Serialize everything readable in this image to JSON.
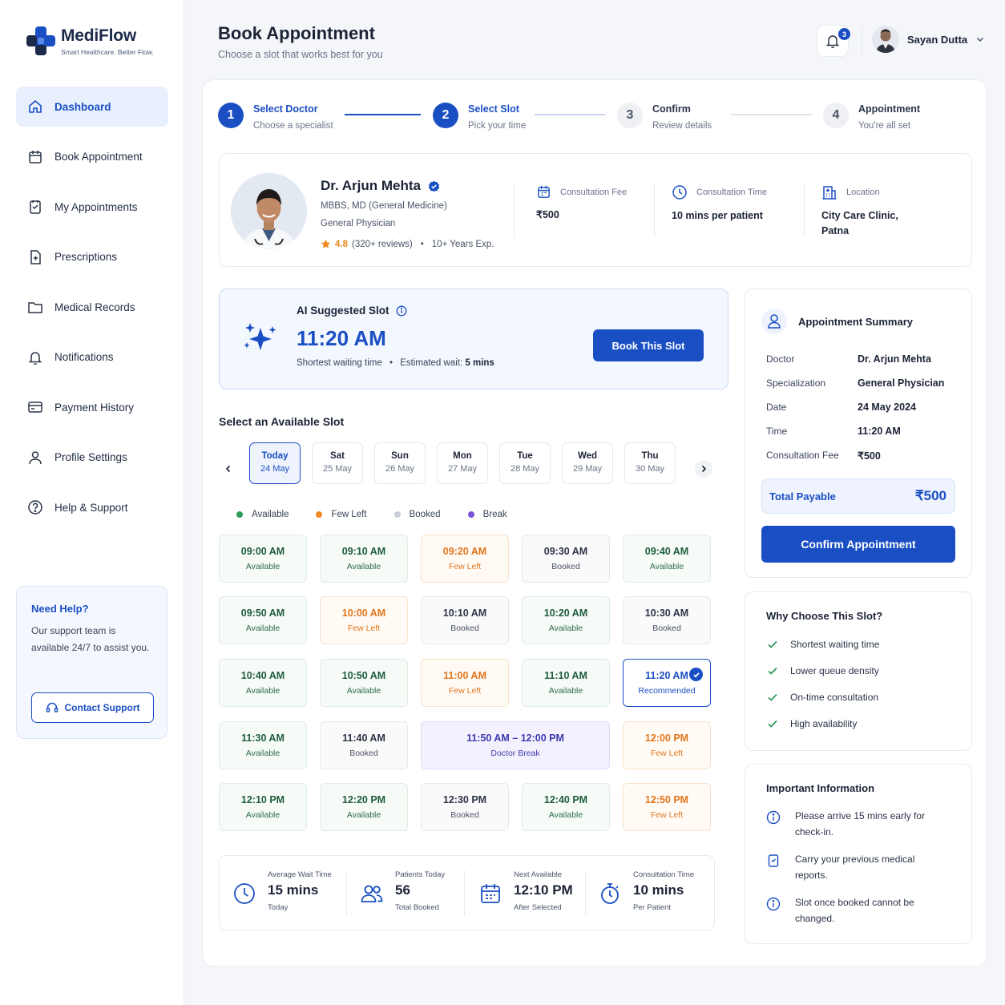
{
  "brand": {
    "name": "MediFlow",
    "tagline": "Smart Healthcare. Better Flow.",
    "accent": "#1a4fc4"
  },
  "sidebar": {
    "items": [
      {
        "label": "Dashboard",
        "icon": "home-icon",
        "active": true
      },
      {
        "label": "Book Appointment",
        "icon": "calendar-icon"
      },
      {
        "label": "My Appointments",
        "icon": "clipboard-calendar-icon"
      },
      {
        "label": "Prescriptions",
        "icon": "prescription-icon"
      },
      {
        "label": "Medical Records",
        "icon": "folder-icon"
      },
      {
        "label": "Notifications",
        "icon": "bell-icon"
      },
      {
        "label": "Payment History",
        "icon": "card-icon"
      },
      {
        "label": "Profile Settings",
        "icon": "user-icon"
      },
      {
        "label": "Help & Support",
        "icon": "question-icon"
      }
    ],
    "help": {
      "title": "Need Help?",
      "text": "Our support team is available 24/7 to assist you.",
      "button": "Contact Support"
    }
  },
  "header": {
    "title": "Book Appointment",
    "subtitle": "Choose a slot that works best for you",
    "notification_count": "3",
    "user_name": "Sayan Dutta"
  },
  "steps": [
    {
      "num": "1",
      "title": "Select Doctor",
      "sub": "Choose a specialist",
      "state": "done"
    },
    {
      "num": "2",
      "title": "Select Slot",
      "sub": "Pick your time",
      "state": "current"
    },
    {
      "num": "3",
      "title": "Confirm",
      "sub": "Review details",
      "state": "todo"
    },
    {
      "num": "4",
      "title": "Appointment",
      "sub": "You're all set",
      "state": "todo"
    }
  ],
  "doctor": {
    "name": "Dr. Arjun Mehta",
    "degree": "MBBS, MD (General Medicine)",
    "specialty": "General Physician",
    "rating": "4.8",
    "reviews": "(320+ reviews)",
    "experience": "10+ Years Exp.",
    "fee_label": "Consultation Fee",
    "fee": "₹500",
    "time_label": "Consultation Time",
    "time": "10 mins per patient",
    "location_label": "Location",
    "location": "City Care Clinic, Patna"
  },
  "ai_slot": {
    "title": "AI Suggested Slot",
    "time": "11:20 AM",
    "note": "Shortest waiting time",
    "wait_label": "Estimated wait:",
    "wait": "5 mins",
    "button": "Book This Slot"
  },
  "slots_section": {
    "title": "Select an Available Slot",
    "days": [
      {
        "d": "Today",
        "date": "24 May",
        "selected": true
      },
      {
        "d": "Sat",
        "date": "25 May"
      },
      {
        "d": "Sun",
        "date": "26 May"
      },
      {
        "d": "Mon",
        "date": "27 May"
      },
      {
        "d": "Tue",
        "date": "28 May"
      },
      {
        "d": "Wed",
        "date": "29 May"
      },
      {
        "d": "Thu",
        "date": "30 May"
      }
    ],
    "legend": [
      {
        "label": "Available",
        "color": "#2e9a5c"
      },
      {
        "label": "Few Left",
        "color": "#f08a24"
      },
      {
        "label": "Booked",
        "color": "#c9ced8"
      },
      {
        "label": "Break",
        "color": "#7a52d6"
      }
    ],
    "rows": [
      [
        {
          "time": "09:00 AM",
          "status": "Available",
          "kind": "av"
        },
        {
          "time": "09:10 AM",
          "status": "Available",
          "kind": "av"
        },
        {
          "time": "09:20 AM",
          "status": "Few Left",
          "kind": "fl"
        },
        {
          "time": "09:30 AM",
          "status": "Booked",
          "kind": "bk"
        },
        {
          "time": "09:40 AM",
          "status": "Available",
          "kind": "av"
        }
      ],
      [
        {
          "time": "09:50 AM",
          "status": "Available",
          "kind": "av"
        },
        {
          "time": "10:00 AM",
          "status": "Few Left",
          "kind": "fl"
        },
        {
          "time": "10:10 AM",
          "status": "Booked",
          "kind": "bk"
        },
        {
          "time": "10:20 AM",
          "status": "Available",
          "kind": "av"
        },
        {
          "time": "10:30 AM",
          "status": "Booked",
          "kind": "bk"
        }
      ],
      [
        {
          "time": "10:40 AM",
          "status": "Available",
          "kind": "av"
        },
        {
          "time": "10:50 AM",
          "status": "Available",
          "kind": "av"
        },
        {
          "time": "11:00 AM",
          "status": "Few Left",
          "kind": "fl"
        },
        {
          "time": "11:10 AM",
          "status": "Available",
          "kind": "av"
        },
        {
          "time": "11:20 AM",
          "status": "Recommended",
          "kind": "rc"
        }
      ],
      [
        {
          "time": "11:30 AM",
          "status": "Available",
          "kind": "av"
        },
        {
          "time": "11:40 AM",
          "status": "Booked",
          "kind": "bk"
        },
        {
          "time": "11:50 AM – 12:00 PM",
          "status": "Doctor Break",
          "kind": "br"
        },
        {
          "time": "12:00 PM",
          "status": "Few Left",
          "kind": "fl"
        }
      ],
      [
        {
          "time": "12:10 PM",
          "status": "Available",
          "kind": "av"
        },
        {
          "time": "12:20 PM",
          "status": "Available",
          "kind": "av"
        },
        {
          "time": "12:30 PM",
          "status": "Booked",
          "kind": "bk"
        },
        {
          "time": "12:40 PM",
          "status": "Available",
          "kind": "av"
        },
        {
          "time": "12:50 PM",
          "status": "Few Left",
          "kind": "fl"
        }
      ]
    ]
  },
  "stats": [
    {
      "label": "Average Wait Time",
      "value": "15 mins",
      "sub": "Today",
      "icon": "clock-icon"
    },
    {
      "label": "Patients Today",
      "value": "56",
      "sub": "Total Booked",
      "icon": "users-icon"
    },
    {
      "label": "Next Available",
      "value": "12:10 PM",
      "sub": "After Selected",
      "icon": "calendar-icon"
    },
    {
      "label": "Consultation Time",
      "value": "10 mins",
      "sub": "Per Patient",
      "icon": "stopwatch-icon"
    }
  ],
  "summary": {
    "title": "Appointment Summary",
    "rows": [
      {
        "k": "Doctor",
        "v": "Dr. Arjun Mehta"
      },
      {
        "k": "Specialization",
        "v": "General Physician"
      },
      {
        "k": "Date",
        "v": "24 May 2024"
      },
      {
        "k": "Time",
        "v": "11:20 AM"
      },
      {
        "k": "Consultation Fee",
        "v": "₹500"
      }
    ],
    "total_label": "Total Payable",
    "total": "₹500",
    "confirm": "Confirm Appointment"
  },
  "why": {
    "title": "Why Choose This Slot?",
    "items": [
      "Shortest waiting time",
      "Lower queue density",
      "On-time consultation",
      "High availability"
    ]
  },
  "important": {
    "title": "Important Information",
    "items": [
      {
        "text": "Please arrive 15 mins early for check-in.",
        "icon": "info-icon"
      },
      {
        "text": "Carry your previous medical reports.",
        "icon": "document-icon"
      },
      {
        "text": "Slot once booked cannot be changed.",
        "icon": "info-icon"
      }
    ]
  }
}
